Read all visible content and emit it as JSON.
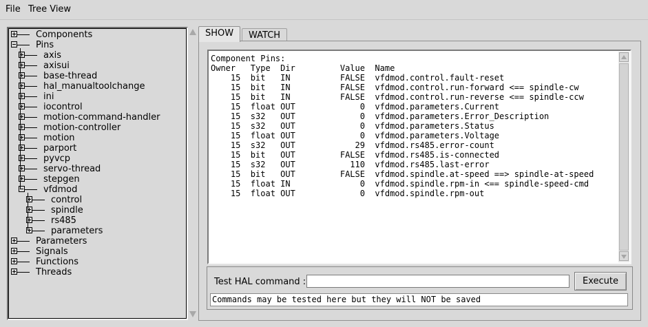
{
  "menubar": {
    "items": [
      "File",
      "Tree View"
    ]
  },
  "tree": {
    "rows": [
      {
        "label": "Components",
        "level": 0,
        "expanded": false
      },
      {
        "label": "Pins",
        "level": 0,
        "expanded": true
      },
      {
        "label": "axis",
        "level": 1,
        "expanded": false
      },
      {
        "label": "axisui",
        "level": 1,
        "expanded": false
      },
      {
        "label": "base-thread",
        "level": 1,
        "expanded": false
      },
      {
        "label": "hal_manualtoolchange",
        "level": 1,
        "expanded": false
      },
      {
        "label": "ini",
        "level": 1,
        "expanded": false
      },
      {
        "label": "iocontrol",
        "level": 1,
        "expanded": false
      },
      {
        "label": "motion-command-handler",
        "level": 1,
        "expanded": false
      },
      {
        "label": "motion-controller",
        "level": 1,
        "expanded": false
      },
      {
        "label": "motion",
        "level": 1,
        "expanded": false
      },
      {
        "label": "parport",
        "level": 1,
        "expanded": false
      },
      {
        "label": "pyvcp",
        "level": 1,
        "expanded": false
      },
      {
        "label": "servo-thread",
        "level": 1,
        "expanded": false
      },
      {
        "label": "stepgen",
        "level": 1,
        "expanded": false
      },
      {
        "label": "vfdmod",
        "level": 1,
        "expanded": true
      },
      {
        "label": "control",
        "level": 2,
        "expanded": false
      },
      {
        "label": "spindle",
        "level": 2,
        "expanded": false
      },
      {
        "label": "rs485",
        "level": 2,
        "expanded": false
      },
      {
        "label": "parameters",
        "level": 2,
        "expanded": false
      },
      {
        "label": "Parameters",
        "level": 0,
        "expanded": false
      },
      {
        "label": "Signals",
        "level": 0,
        "expanded": false
      },
      {
        "label": "Functions",
        "level": 0,
        "expanded": false
      },
      {
        "label": "Threads",
        "level": 0,
        "expanded": false
      }
    ]
  },
  "tabs": {
    "show": "SHOW",
    "watch": "WATCH"
  },
  "output": {
    "lines": [
      "Component Pins:",
      "Owner   Type  Dir         Value  Name",
      "    15  bit   IN          FALSE  vfdmod.control.fault-reset",
      "    15  bit   IN          FALSE  vfdmod.control.run-forward <== spindle-cw",
      "    15  bit   IN          FALSE  vfdmod.control.run-reverse <== spindle-ccw",
      "    15  float OUT             0  vfdmod.parameters.Current",
      "    15  s32   OUT             0  vfdmod.parameters.Error_Description",
      "    15  s32   OUT             0  vfdmod.parameters.Status",
      "    15  float OUT             0  vfdmod.parameters.Voltage",
      "    15  s32   OUT            29  vfdmod.rs485.error-count",
      "    15  bit   OUT         FALSE  vfdmod.rs485.is-connected",
      "    15  s32   OUT           110  vfdmod.rs485.last-error",
      "    15  bit   OUT         FALSE  vfdmod.spindle.at-speed ==> spindle-at-speed",
      "    15  float IN              0  vfdmod.spindle.rpm-in <== spindle-speed-cmd",
      "    15  float OUT             0  vfdmod.spindle.rpm-out"
    ]
  },
  "command": {
    "label": "Test HAL command :",
    "value": "",
    "button": "Execute",
    "status": "Commands may be tested here but they will NOT be saved"
  }
}
